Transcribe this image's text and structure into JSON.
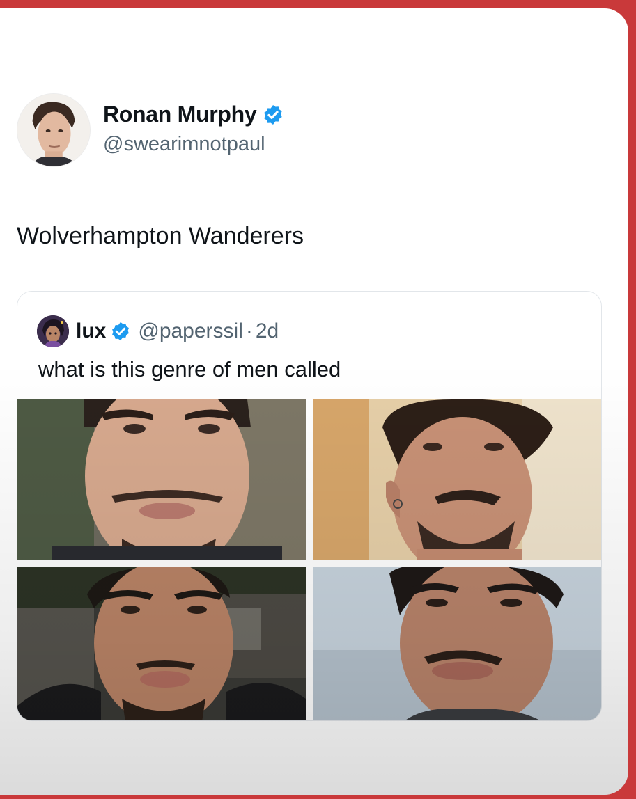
{
  "tweet": {
    "author": {
      "display_name": "Ronan Murphy",
      "handle": "@swearimnotpaul",
      "verified_icon": "verified-badge-icon"
    },
    "text": "Wolverhampton Wanderers"
  },
  "quoted_tweet": {
    "author": {
      "display_name": "lux",
      "handle": "@paperssil",
      "separator": "·",
      "time": "2d",
      "verified_icon": "verified-badge-icon"
    },
    "text": "what is this genre of men called",
    "photos": [
      "photo-1",
      "photo-2",
      "photo-3",
      "photo-4"
    ]
  },
  "colors": {
    "border_red": "#c9393a",
    "verified_blue": "#1d9bf0",
    "text_primary": "#0f1419",
    "text_secondary": "#536471"
  }
}
